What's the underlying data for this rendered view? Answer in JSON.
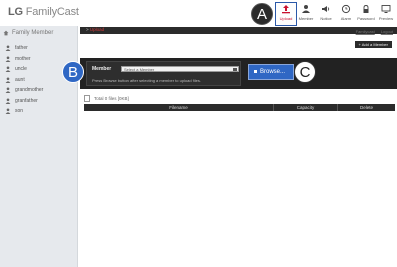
{
  "header": {
    "logo_bold": "LG",
    "logo_rest": " FamilyCast",
    "tools": [
      {
        "label": "Upload",
        "icon": "upload-icon"
      },
      {
        "label": "Member",
        "icon": "member-icon"
      },
      {
        "label": "Notice",
        "icon": "notice-icon"
      },
      {
        "label": "Alarm",
        "icon": "alarm-icon"
      },
      {
        "label": "Password",
        "icon": "password-icon"
      },
      {
        "label": "Preview",
        "icon": "preview-icon"
      }
    ]
  },
  "sidebar": {
    "title": "Family Member",
    "members": [
      {
        "label": "father"
      },
      {
        "label": "mother"
      },
      {
        "label": "uncle"
      },
      {
        "label": "aunt"
      },
      {
        "label": "grandmother"
      },
      {
        "label": "granfather"
      },
      {
        "label": "son"
      }
    ]
  },
  "content": {
    "breadcrumb_prefix": "> ",
    "breadcrumb_current": "Upload",
    "links": {
      "left": "Familycast",
      "right": "Logout"
    },
    "add_member": "+ Add a Member",
    "upload": {
      "member_label": "Member",
      "select_value": "Select a Member",
      "hint": "Press Browse button after selecting a member to upload files.",
      "browse": "Browse..."
    },
    "total": "Total 0 files [0KB]",
    "columns": [
      "Filename",
      "Capacity",
      "Delete"
    ]
  },
  "callouts": {
    "a": "A",
    "b": "B",
    "c": "C"
  }
}
